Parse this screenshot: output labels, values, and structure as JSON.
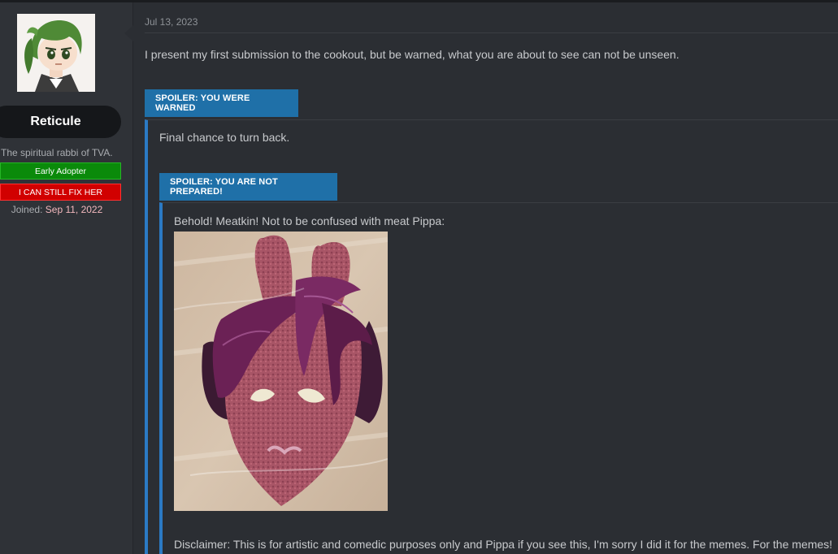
{
  "user": {
    "name": "Reticule",
    "title": "The spiritual rabbi of TVA.",
    "badges": [
      "Early Adopter",
      "I CAN STILL FIX HER"
    ],
    "joined_label": "Joined:",
    "joined_date": "Sep 11, 2022"
  },
  "post": {
    "date": "Jul 13, 2023",
    "intro": "I present my first submission to the cookout, but be warned, what you are about to see can not be unseen.",
    "spoiler1": {
      "label": "SPOILER: YOU WERE WARNED",
      "text": "Final chance to turn back."
    },
    "spoiler2": {
      "label": "SPOILER: YOU ARE NOT PREPARED!",
      "text": "Behold! Meatkin! Not to be confused with meat Pippa:"
    },
    "disclaimer": "Disclaimer: This is for artistic and comedic purposes only and Pippa if you see this, I'm sorry I did it for the memes. For the memes!"
  },
  "colors": {
    "background": "#2b2e33",
    "sidebar": "#2f3237",
    "spoiler_button": "#1f70a8",
    "spoiler_border": "#2b7ac4",
    "badge_green": "#0a8a0a",
    "badge_red": "#d10000"
  }
}
